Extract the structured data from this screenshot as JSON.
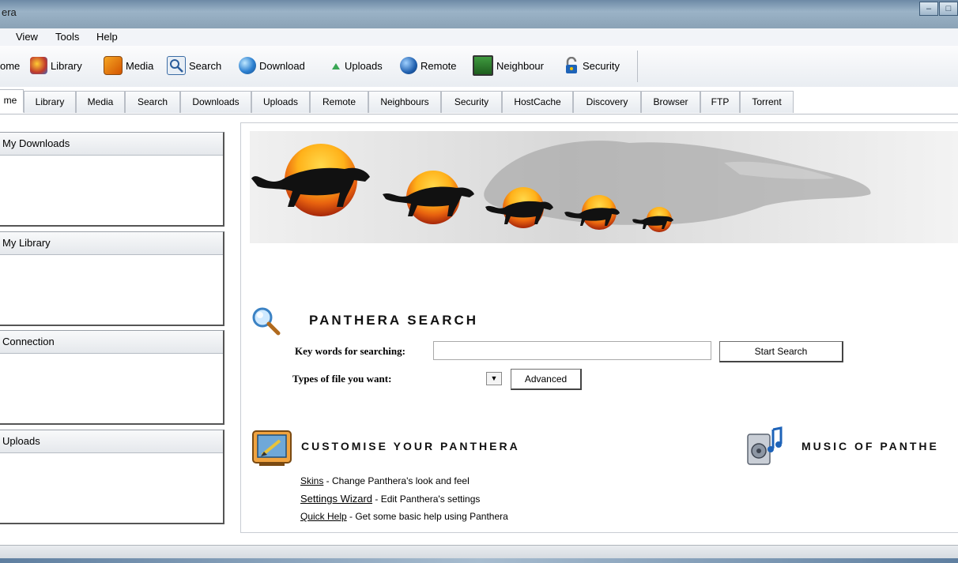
{
  "window": {
    "title": "era"
  },
  "menu": {
    "items": [
      "View",
      "Tools",
      "Help"
    ],
    "partial": ""
  },
  "toolbar": {
    "items": [
      "ome",
      "Library",
      "Media",
      "Search",
      "Download",
      "Uploads",
      "Remote",
      "Neighbour",
      "Security"
    ]
  },
  "tabs": [
    {
      "label": "me"
    },
    {
      "label": "Library"
    },
    {
      "label": "Media"
    },
    {
      "label": "Search"
    },
    {
      "label": "Downloads"
    },
    {
      "label": "Uploads"
    },
    {
      "label": "Remote"
    },
    {
      "label": "Neighbours"
    },
    {
      "label": "Security"
    },
    {
      "label": "HostCache"
    },
    {
      "label": "Discovery"
    },
    {
      "label": "Browser"
    },
    {
      "label": "FTP"
    },
    {
      "label": "Torrent"
    }
  ],
  "left_panels": [
    "My Downloads",
    "My Library",
    "Connection",
    "Uploads"
  ],
  "search": {
    "title": "PANTHERA SEARCH",
    "keywords_label": "Key words for searching:",
    "keywords_value": "",
    "start_button": "Start Search",
    "types_label": "Types of file you want:",
    "types_value": "",
    "advanced_button": "Advanced"
  },
  "customise": {
    "title": "CUSTOMISE YOUR PANTHERA",
    "links": [
      {
        "link": "Skins",
        "desc": " - Change Panthera's look and feel"
      },
      {
        "link": "Settings Wizard",
        "desc": " - Edit Panthera's settings"
      },
      {
        "link": "Quick Help",
        "desc": " - Get some basic help using Panthera"
      }
    ]
  },
  "music": {
    "title": "MUSIC OF PANTHE"
  },
  "colors": {
    "accent_orange": "#e8620f",
    "accent_yellow": "#ffc21a",
    "title_bar": "#8aa2b6"
  }
}
